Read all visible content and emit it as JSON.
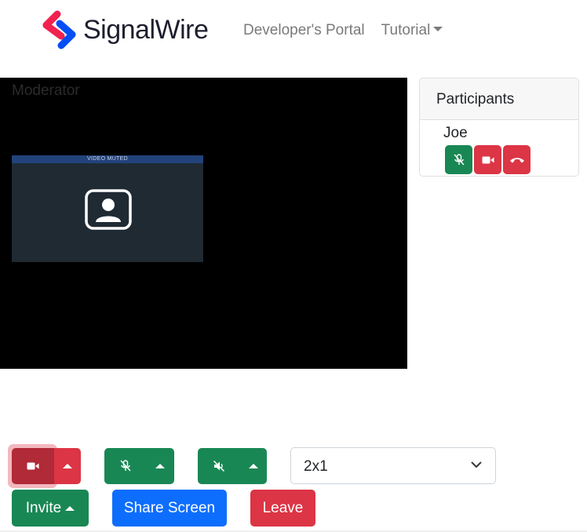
{
  "header": {
    "brand_name": "SignalWire",
    "nav": {
      "developers_portal": "Developer's Portal",
      "tutorial": "Tutorial"
    }
  },
  "video": {
    "layer_label": "Moderator",
    "tile_status": "VIDEO MUTED"
  },
  "participants": {
    "title": "Participants",
    "list": [
      {
        "name": "Joe"
      }
    ]
  },
  "controls": {
    "layout_select_value": "2x1",
    "invite_label": "Invite",
    "share_screen_label": "Share Screen",
    "leave_label": "Leave"
  },
  "icons": {
    "camera": "video-camera-icon",
    "mic_muted": "microphone-slash-icon",
    "speaker_muted": "speaker-slash-icon",
    "hangup": "phone-hangup-icon",
    "dropdown": "chevron-down-icon",
    "avatar": "user-square-icon"
  },
  "colors": {
    "success": "#198754",
    "danger": "#dc3545",
    "primary": "#0d6efd",
    "brand_red": "#f0224e",
    "brand_blue": "#044ef4"
  }
}
